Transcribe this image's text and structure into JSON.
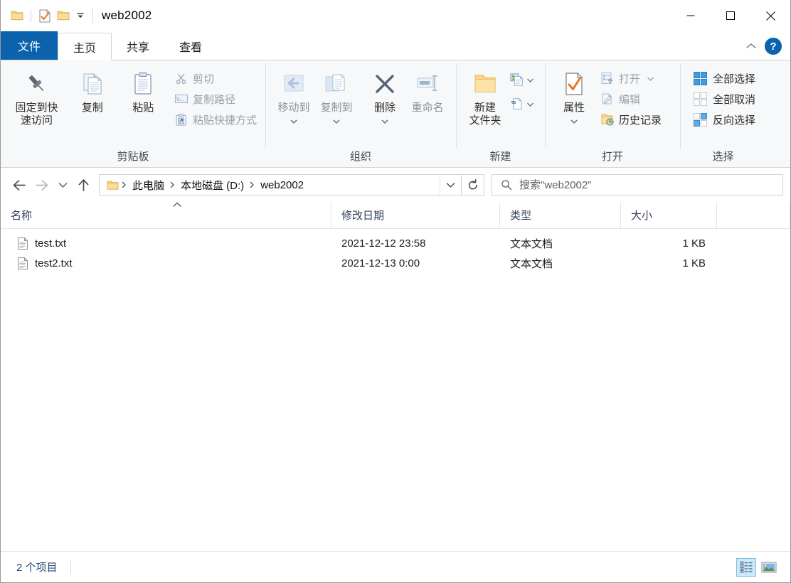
{
  "window": {
    "title": "web2002",
    "minimize_label": "最小化",
    "maximize_label": "最大化",
    "close_label": "关闭"
  },
  "quick_access": {
    "items": [
      {
        "name": "folder-icon",
        "label": "文件夹"
      },
      {
        "name": "properties-icon",
        "label": "属性"
      },
      {
        "name": "new-folder-icon",
        "label": "新建文件夹"
      }
    ],
    "dropdown_label": "自定义快速访问工具栏"
  },
  "tabs": [
    {
      "id": "file",
      "label": "文件",
      "state": "menu"
    },
    {
      "id": "home",
      "label": "主页",
      "state": "active"
    },
    {
      "id": "share",
      "label": "共享",
      "state": "normal"
    },
    {
      "id": "view",
      "label": "查看",
      "state": "normal"
    }
  ],
  "ribbon_right": {
    "collapse_label": "折叠功能区",
    "help_label": "?"
  },
  "ribbon": {
    "groups": [
      {
        "id": "clipboard",
        "label": "剪贴板",
        "big_buttons": [
          {
            "name": "pin-to-quick-access",
            "label": "固定到快\n速访问",
            "icon": "pin-icon",
            "dim": false
          },
          {
            "name": "copy",
            "label": "复制",
            "icon": "copy-icon",
            "dim": false
          },
          {
            "name": "paste",
            "label": "粘贴",
            "icon": "paste-icon",
            "dim": false
          }
        ],
        "small_buttons": [
          {
            "name": "cut",
            "label": "剪切",
            "icon": "scissors-icon",
            "dim": true
          },
          {
            "name": "copy-path",
            "label": "复制路径",
            "icon": "copy-path-icon",
            "dim": true
          },
          {
            "name": "paste-shortcut",
            "label": "粘贴快捷方式",
            "icon": "paste-shortcut-icon",
            "dim": true
          }
        ]
      },
      {
        "id": "organize",
        "label": "组织",
        "big_buttons": [
          {
            "name": "move-to",
            "label": "移动到",
            "icon": "move-to-icon",
            "dim": true,
            "caret": true
          },
          {
            "name": "copy-to",
            "label": "复制到",
            "icon": "copy-to-icon",
            "dim": true,
            "caret": true
          },
          {
            "name": "delete",
            "label": "删除",
            "icon": "delete-icon",
            "dim": false,
            "caret": true
          },
          {
            "name": "rename",
            "label": "重命名",
            "icon": "rename-icon",
            "dim": true
          }
        ],
        "small_buttons": []
      },
      {
        "id": "new",
        "label": "新建",
        "big_buttons": [
          {
            "name": "new-folder",
            "label": "新建\n文件夹",
            "icon": "new-folder-big-icon",
            "dim": false
          }
        ],
        "small_buttons": [
          {
            "name": "new-item",
            "label": "",
            "icon": "new-item-icon",
            "dim": false,
            "caret": true
          },
          {
            "name": "easy-access",
            "label": "",
            "icon": "easy-access-icon",
            "dim": false,
            "caret": true
          }
        ]
      },
      {
        "id": "open",
        "label": "打开",
        "big_buttons": [
          {
            "name": "properties",
            "label": "属性",
            "icon": "properties-big-icon",
            "dim": false,
            "caret": true
          }
        ],
        "small_buttons": [
          {
            "name": "open",
            "label": "打开",
            "icon": "open-icon",
            "dim": true,
            "caret": true
          },
          {
            "name": "edit",
            "label": "编辑",
            "icon": "edit-icon",
            "dim": true
          },
          {
            "name": "history",
            "label": "历史记录",
            "icon": "history-icon",
            "dim": false
          }
        ]
      },
      {
        "id": "select",
        "label": "选择",
        "big_buttons": [],
        "small_buttons": [
          {
            "name": "select-all",
            "label": "全部选择",
            "icon": "select-all-icon",
            "dim": false
          },
          {
            "name": "select-none",
            "label": "全部取消",
            "icon": "select-none-icon",
            "dim": false
          },
          {
            "name": "invert-selection",
            "label": "反向选择",
            "icon": "invert-selection-icon",
            "dim": false
          }
        ]
      }
    ]
  },
  "navigation": {
    "back_label": "后退",
    "forward_label": "前进",
    "recent_label": "最近使用的位置",
    "up_label": "上移一级",
    "breadcrumbs": [
      "此电脑",
      "本地磁盘 (D:)",
      "web2002"
    ],
    "breadcrumb_dropdown_label": "以前的位置",
    "refresh_label": "刷新"
  },
  "search": {
    "placeholder": "搜索\"web2002\"",
    "value": "",
    "icon": "search-icon"
  },
  "columns": [
    {
      "id": "name",
      "label": "名称",
      "sorted": "asc"
    },
    {
      "id": "date",
      "label": "修改日期",
      "sorted": ""
    },
    {
      "id": "type",
      "label": "类型",
      "sorted": ""
    },
    {
      "id": "size",
      "label": "大小",
      "sorted": ""
    }
  ],
  "files": [
    {
      "icon": "text-file-icon",
      "name": "test.txt",
      "date_modified": "2021-12-12 23:58",
      "type": "文本文档",
      "size": "1 KB"
    },
    {
      "icon": "text-file-icon",
      "name": "test2.txt",
      "date_modified": "2021-12-13 0:00",
      "type": "文本文档",
      "size": "1 KB"
    }
  ],
  "status": {
    "item_count": "2 个项目",
    "views": [
      {
        "name": "details-view-button",
        "label": "详细信息",
        "selected": true
      },
      {
        "name": "large-icons-view-button",
        "label": "大图标",
        "selected": false
      }
    ]
  },
  "colors": {
    "accent": "#0b63ad",
    "ribbon_bg": "#f7f8f9",
    "folder_yellow": "#fcd77f",
    "border": "#d4d4d4",
    "header_text": "#33445c"
  }
}
